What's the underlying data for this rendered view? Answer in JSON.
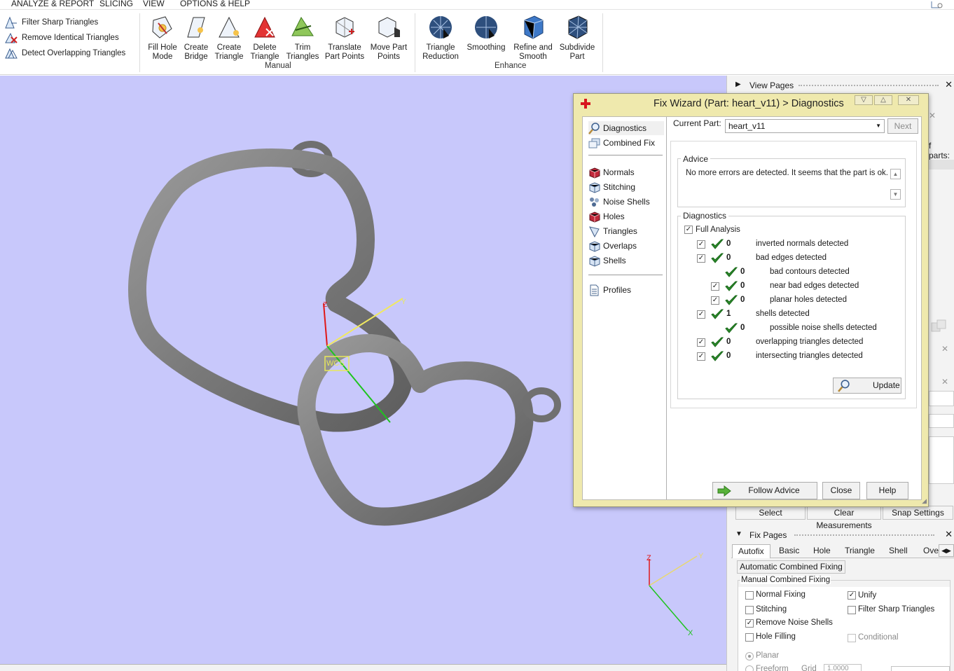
{
  "menu": [
    "ANALYZE & REPORT",
    "SLICING",
    "VIEW",
    "OPTIONS & HELP"
  ],
  "ribbon": {
    "quick": [
      "Filter Sharp Triangles",
      "Remove Identical Triangles",
      "Detect Overlapping Triangles"
    ],
    "manual_tools": [
      {
        "l1": "Fill Hole",
        "l2": "Mode"
      },
      {
        "l1": "Create",
        "l2": "Bridge"
      },
      {
        "l1": "Create",
        "l2": "Triangle"
      },
      {
        "l1": "Delete",
        "l2": "Triangle"
      },
      {
        "l1": "Trim",
        "l2": "Triangles"
      },
      {
        "l1": "Translate",
        "l2": "Part Points"
      },
      {
        "l1": "Move Part",
        "l2": "Points"
      }
    ],
    "enhance_tools": [
      {
        "l1": "Triangle",
        "l2": "Reduction"
      },
      {
        "l1": "Smoothing",
        "l2": ""
      },
      {
        "l1": "Refine and",
        "l2": "Smooth"
      },
      {
        "l1": "Subdivide",
        "l2": "Part"
      }
    ],
    "group_manual": "Manual",
    "group_enhance": "Enhance"
  },
  "viewport": {
    "axis_z": "Z",
    "axis_y": "Y",
    "axis_x": "X",
    "wcs": "WCS",
    "bg": "#c8c8fb"
  },
  "right_panel": {
    "view_pages": "View Pages",
    "fparts": "f parts:",
    "select": "Select",
    "clear_measurements": "Clear Measurements",
    "snap_settings": "Snap Settings",
    "fix_pages": "Fix Pages",
    "tabs": [
      "Autofix",
      "Basic",
      "Hole",
      "Triangle",
      "Shell",
      "Over"
    ],
    "auto_combined": "Automatic Combined Fixing",
    "manual_combined": "Manual Combined Fixing",
    "normal_fixing": "Normal Fixing",
    "unify": "Unify",
    "stitching": "Stitching",
    "filter_sharp": "Filter Sharp Triangles",
    "remove_noise": "Remove Noise Shells",
    "hole_filling": "Hole Filling",
    "conditional": "Conditional",
    "planar": "Planar",
    "freeform": "Freeform",
    "grid": "Grid",
    "grid_value": "1.0000"
  },
  "dialog": {
    "title": "Fix Wizard (Part: heart_v11) > Diagnostics",
    "nav_top": [
      "Diagnostics",
      "Combined Fix"
    ],
    "nav_mid": [
      "Normals",
      "Stitching",
      "Noise Shells",
      "Holes",
      "Triangles",
      "Overlaps",
      "Shells"
    ],
    "nav_bot": [
      "Profiles"
    ],
    "current_part_label": "Current Part:",
    "current_part": "heart_v11",
    "next": "Next",
    "advice_label": "Advice",
    "advice_text": "No more errors are detected. It seems that the part is ok.",
    "diagnostics_label": "Diagnostics",
    "full_analysis": "Full Analysis",
    "rows": [
      {
        "n": "0",
        "t": "inverted normals detected"
      },
      {
        "n": "0",
        "t": "bad edges detected"
      },
      {
        "n": "0",
        "t": "bad contours detected"
      },
      {
        "n": "0",
        "t": "near bad edges detected"
      },
      {
        "n": "0",
        "t": "planar holes detected"
      },
      {
        "n": "1",
        "t": "shells detected"
      },
      {
        "n": "0",
        "t": "possible noise shells detected"
      },
      {
        "n": "0",
        "t": "overlapping triangles detected"
      },
      {
        "n": "0",
        "t": "intersecting triangles detected"
      }
    ],
    "update": "Update",
    "follow_advice": "Follow Advice",
    "close": "Close",
    "help": "Help"
  }
}
